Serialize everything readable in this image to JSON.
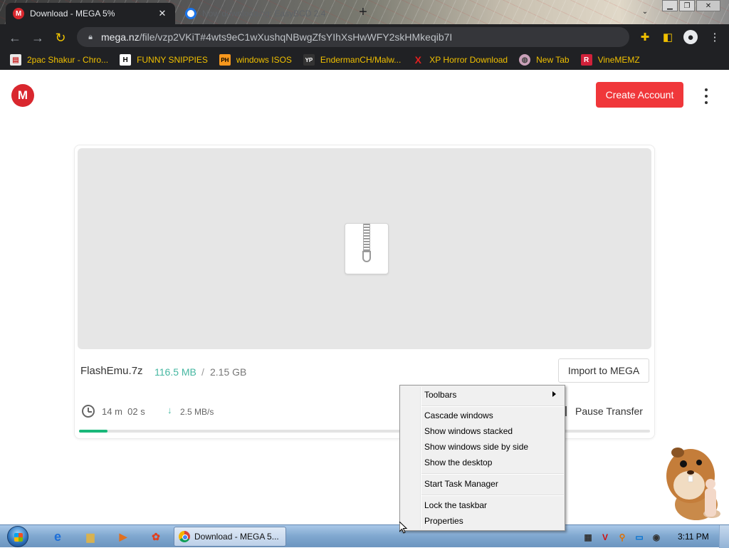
{
  "browser": {
    "tabs": [
      {
        "title": "Download - MEGA 5%",
        "favicon": "mega-icon",
        "active": true
      },
      {
        "title": "Now downloading: EasyBCD 2.4",
        "favicon": "neosmart-icon",
        "active": false
      }
    ],
    "url_host": "mega.nz",
    "url_path": "/file/vzp2VKiT#4wts9eC1wXushqNBwgZfsYIhXsHwWFY2skHMkeqib7I",
    "bookmarks": [
      {
        "label": "2pac Shakur - Chro...",
        "icon": "chrome-store-icon"
      },
      {
        "label": "FUNNY SNIPPIES",
        "icon": "h-icon"
      },
      {
        "label": "windows ISOS",
        "icon": "ph-icon"
      },
      {
        "label": "EndermanCH/Malw...",
        "icon": "yp-icon"
      },
      {
        "label": "XP Horror Download",
        "icon": "x-icon"
      },
      {
        "label": "New Tab",
        "icon": "globe-icon"
      },
      {
        "label": "VineMEMZ",
        "icon": "r-icon"
      }
    ]
  },
  "page": {
    "logo_letter": "M",
    "create_account": "Create Account",
    "file": {
      "name": "FlashEmu.7z",
      "downloaded": "116.5 MB",
      "separator": "/",
      "total": "2.15 GB",
      "import_label": "Import to MEGA",
      "eta": "14 m  02 s",
      "speed": "2.5 MB/s",
      "pause_label": "Pause Transfer",
      "progress": 0.05
    }
  },
  "context_menu": {
    "items": [
      "Toolbars",
      "Cascade windows",
      "Show windows stacked",
      "Show windows side by side",
      "Show the desktop",
      "Start Task Manager",
      "Lock the taskbar",
      "Properties"
    ]
  },
  "taskbar": {
    "task_label": "Download - MEGA 5...",
    "time": "3:11 PM"
  },
  "colors": {
    "mega_red": "#d9272e",
    "create_button": "#f0373a",
    "progress_green": "#1ab87a",
    "size_green": "#45b7a1",
    "bookmark_text": "#f0c000",
    "chrome_dark": "#202124"
  }
}
